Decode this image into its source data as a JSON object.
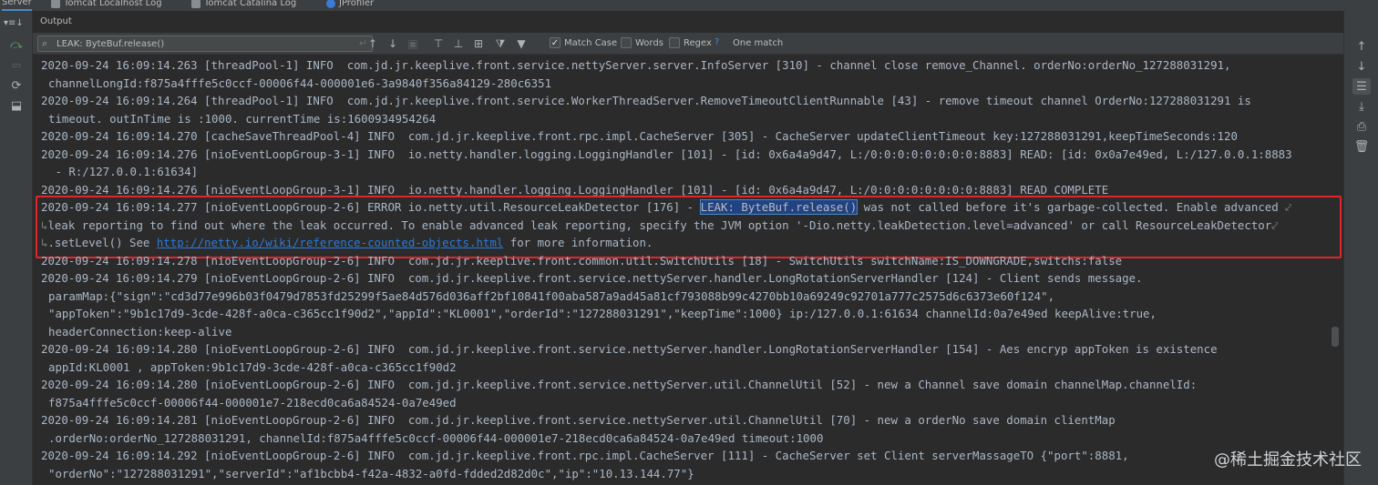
{
  "tabs": [
    "Server",
    "Tomcat Localhost Log",
    "Tomcat Catalina Log",
    "JProfiler"
  ],
  "panel_title": "Output",
  "search": {
    "value": "LEAK: ByteBuf.release()",
    "match_case": "Match Case",
    "words": "Words",
    "regex": "Regex",
    "help": "?",
    "result": "One match"
  },
  "log": {
    "l1": "2020-09-24 16:09:14.263 [threadPool-1] INFO  com.jd.jr.keeplive.front.service.nettyServer.server.InfoServer [310] - channel close remove_Channel. orderNo:orderNo_127288031291,",
    "l2": "channelLongId:f875a4fffe5c0ccf-00006f44-000001e6-3a9840f356a84129-280c6351",
    "l3": "2020-09-24 16:09:14.264 [threadPool-1] INFO  com.jd.jr.keeplive.front.service.WorkerThreadServer.RemoveTimeoutClientRunnable [43] - remove timeout channel OrderNo:127288031291 is",
    "l4": "timeout. outInTime is :1000. currentTime is:1600934954264",
    "l5": "2020-09-24 16:09:14.270 [cacheSaveThreadPool-4] INFO  com.jd.jr.keeplive.front.rpc.impl.CacheServer [305] - CacheServer updateClientTimeout key:127288031291,keepTimeSeconds:120",
    "l6": "2020-09-24 16:09:14.276 [nioEventLoopGroup-3-1] INFO  io.netty.handler.logging.LoggingHandler [101] - [id: 0x6a4a9d47, L:/0:0:0:0:0:0:0:0:8883] READ: [id: 0x0a7e49ed, L:/127.0.0.1:8883",
    "l7": " - R:/127.0.0.1:61634]",
    "l8": "2020-09-24 16:09:14.276 [nioEventLoopGroup-3-1] INFO  io.netty.handler.logging.LoggingHandler [101] - [id: 0x6a4a9d47, L:/0:0:0:0:0:0:0:0:8883] READ COMPLETE",
    "err_prefix": "2020-09-24 16:09:14.277 [nioEventLoopGroup-2-6] ERROR io.netty.util.ResourceLeakDetector [176] - ",
    "err_match": "LEAK: ByteBuf.release()",
    "err_suffix": " was not called before it's garbage-collected. Enable advanced ",
    "err_line2": "leak reporting to find out where the leak occurred. To enable advanced leak reporting, specify the JVM option '-Dio.netty.leakDetection.level=advanced' or call ResourceLeakDetector",
    "err_line3_pre": ".setLevel() See ",
    "err_link": "http://netty.io/wiki/reference-counted-objects.html",
    "err_line3_post": " for more information.",
    "l12": "2020-09-24 16:09:14.278 [nioEventLoopGroup-2-6] INFO  com.jd.jr.keeplive.front.common.util.SwitchUtils [18] - SwitchUtils switchName:IS_DOWNGRADE,switchs:false",
    "l13": "2020-09-24 16:09:14.279 [nioEventLoopGroup-2-6] INFO  com.jd.jr.keeplive.front.service.nettyServer.handler.LongRotationServerHandler [124] - Client sends message.",
    "l14": "paramMap:{\"sign\":\"cd3d77e996b03f0479d7853fd25299f5ae84d576d036aff2bf10841f00aba587a9ad45a81cf793088b99c4270bb10a69249c92701a777c2575d6c6373e60f124\",",
    "l15": "\"appToken\":\"9b1c17d9-3cde-428f-a0ca-c365cc1f90d2\",\"appId\":\"KL0001\",\"orderId\":\"127288031291\",\"keepTime\":1000} ip:/127.0.0.1:61634 channelId:0a7e49ed keepAlive:true,",
    "l16": "headerConnection:keep-alive",
    "l17": "2020-09-24 16:09:14.280 [nioEventLoopGroup-2-6] INFO  com.jd.jr.keeplive.front.service.nettyServer.handler.LongRotationServerHandler [154] - Aes encryp appToken is existence",
    "l18": "appId:KL0001 , appToken:9b1c17d9-3cde-428f-a0ca-c365cc1f90d2",
    "l19": "2020-09-24 16:09:14.280 [nioEventLoopGroup-2-6] INFO  com.jd.jr.keeplive.front.service.nettyServer.util.ChannelUtil [52] - new a Channel save domain channelMap.channelId:",
    "l20": "f875a4fffe5c0ccf-00006f44-000001e7-218ecd0ca6a84524-0a7e49ed",
    "l21": "2020-09-24 16:09:14.281 [nioEventLoopGroup-2-6] INFO  com.jd.jr.keeplive.front.service.nettyServer.util.ChannelUtil [70] - new a orderNo save domain clientMap",
    "l22": ".orderNo:orderNo_127288031291, channelId:f875a4fffe5c0ccf-00006f44-000001e7-218ecd0ca6a84524-0a7e49ed timeout:1000",
    "l23": "2020-09-24 16:09:14.292 [nioEventLoopGroup-2-6] INFO  com.jd.jr.keeplive.front.rpc.impl.CacheServer [111] - CacheServer set Client serverMassageTO {\"port\":8881,",
    "l24": "\"orderNo\":\"127288031291\",\"serverId\":\"af1bcbb4-f42a-4832-a0fd-fdded2d82d0c\",\"ip\":\"10.13.144.77\"}"
  },
  "watermark": "@稀土掘金技术社区",
  "icons": {
    "search": "magnifier-icon",
    "wrap": "soft-wrap-icon"
  }
}
